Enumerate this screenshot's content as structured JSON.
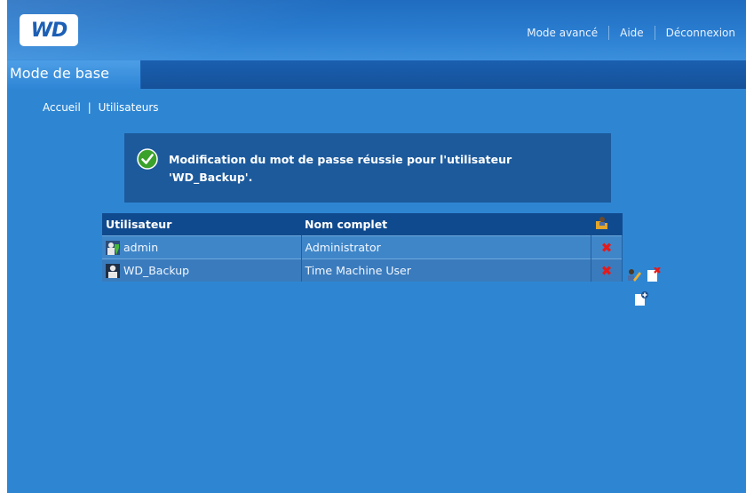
{
  "header": {
    "logo": "WD",
    "nav": [
      "Mode avancé",
      "Aide",
      "Déconnexion"
    ]
  },
  "tabs": {
    "active": "Mode de base"
  },
  "breadcrumb": {
    "home": "Accueil",
    "separator": "|",
    "current": "Utilisateurs"
  },
  "notice": {
    "icon": "check-circle-icon",
    "line1": "Modification du mot de passe réussie pour l'utilisateur",
    "line2": "'WD_Backup'."
  },
  "table": {
    "headers": {
      "user": "Utilisateur",
      "fullname": "Nom complet",
      "action_icon": "user-folder-icon"
    },
    "rows": [
      {
        "user": "admin",
        "fullname": "Administrator",
        "icon": "admin-user-icon",
        "action_icon": "delete-x-icon"
      },
      {
        "user": "WD_Backup",
        "fullname": "Time Machine User",
        "icon": "user-icon",
        "action_icon": "delete-x-icon"
      }
    ]
  },
  "side_actions": [
    "edit-pencil-icon",
    "delete-user-icon",
    "add-user-icon"
  ],
  "colors": {
    "page_bg": "#2e86d3",
    "header": "#1f6cc0",
    "table_header": "#104a8e",
    "table_row": "#3f86c9",
    "notice_bg": "#1c5a9c",
    "delete": "#e51a1a",
    "success": "#3aa12a"
  }
}
